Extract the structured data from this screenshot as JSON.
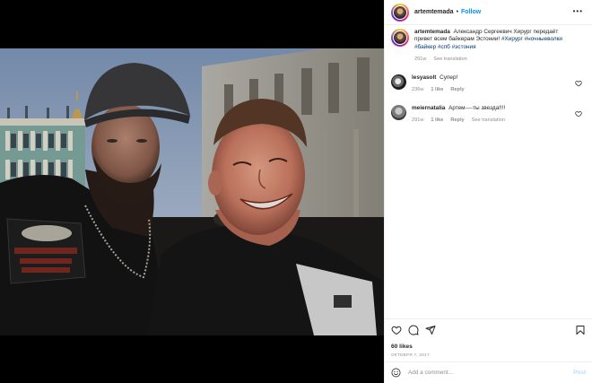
{
  "post": {
    "header": {
      "username": "artemtemada",
      "separator": "•",
      "follow_label": "Follow",
      "more_icon": "more-horizontal-icon"
    },
    "caption": {
      "username": "artemtemada",
      "text": "Александр Сергеевич Хирург передаёт привет всем байкерам Эстонии!",
      "hashtags": "#Хирург #ночныеволки #байкер #спб #эстония",
      "age": "291w",
      "see_translation": "See translation"
    },
    "comments": [
      {
        "username": "lesyasolt",
        "text": "Супер!",
        "age": "236w",
        "likes": "1 like",
        "reply": "Reply"
      },
      {
        "username": "meiernatalia",
        "text": "Артем----ты звезда!!!!",
        "age": "291w",
        "likes": "1 like",
        "reply": "Reply",
        "see_translation": "See translation"
      }
    ],
    "likes_count": "60 likes",
    "date": "ОКТОБРЯ 7, 2017",
    "add_comment": {
      "placeholder": "Add a comment…",
      "post_label": "Post"
    },
    "colors": {
      "link": "#0095f6",
      "hashtag": "#00376b",
      "muted": "#8e8e8e",
      "post_disabled": "#b2dffc"
    }
  }
}
